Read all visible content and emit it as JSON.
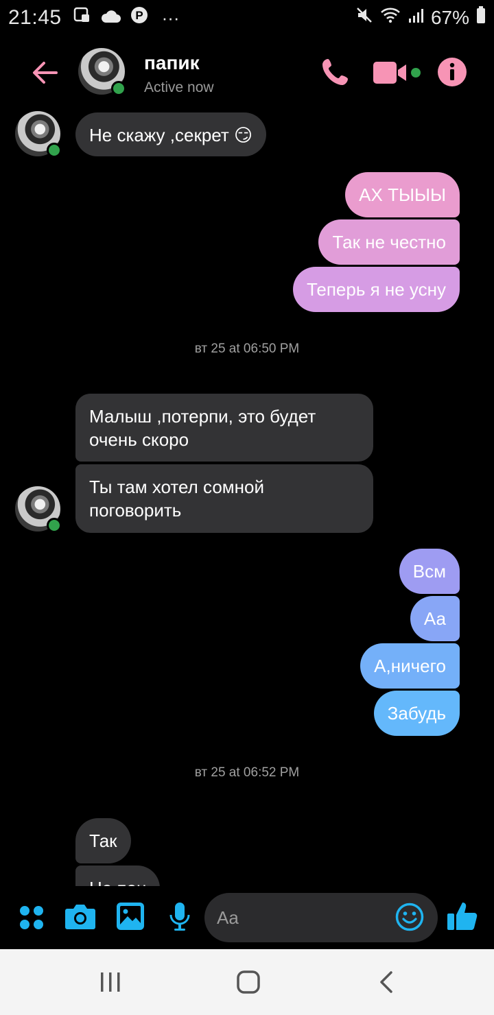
{
  "status_bar": {
    "time": "21:45",
    "dots": "···",
    "battery_percent": "67%",
    "left_icons": [
      "screenshot-icon",
      "cloud-icon",
      "pinterest-icon",
      "more-icon"
    ],
    "right_icons": [
      "mute-icon",
      "wifi-icon",
      "signal-icon",
      "battery-icon"
    ]
  },
  "header": {
    "name": "папик",
    "status": "Active now",
    "accent": "#f794b5"
  },
  "messages": {
    "m1": "Не скажу ,секрет 😏",
    "m2": "АХ ТЫЫЫ",
    "m3": "Так не честно",
    "m4": "Теперь я не усну",
    "ts1": "вт 25 at 06:50 PM",
    "m5_line1": "Малыш ,потерпи, это будет",
    "m5_line2": "очень скоро",
    "m6_line1": "Ты там хотел сомной",
    "m6_line2": "поговорить",
    "m7": "Всм",
    "m8": "Аа",
    "m9": "А,ничего",
    "m10": "Забудь",
    "ts2": "вт 25 at 06:52 PM",
    "m11": "Так",
    "m12_partial": "Не пон"
  },
  "composer": {
    "placeholder": "Aa",
    "accent": "#1fb4f0"
  },
  "colors": {
    "received_bubble": "#333335",
    "sent_pink": "#e99ccf",
    "sent_purple": "#d89be2",
    "sent_violet": "#9f9df3",
    "sent_blue": "#6ab8fa",
    "online": "#31a24c"
  }
}
